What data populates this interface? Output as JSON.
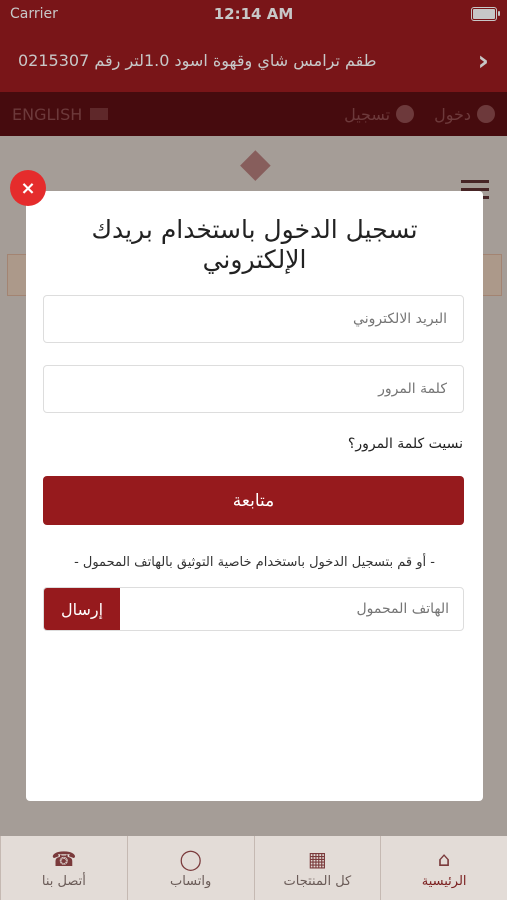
{
  "statusbar": {
    "carrier": "Carrier",
    "time": "12:14 AM"
  },
  "header": {
    "title": "طقم ترامس شاي وقهوة اسود 1.0لتر رقم 0215307",
    "back_icon": "chevron-right-icon"
  },
  "topnav": {
    "language": "ENGLISH",
    "login": "دخول",
    "register": "تسجيل"
  },
  "modal": {
    "title": "تسجيل الدخول باستخدام بريدك الإلكتروني",
    "email_placeholder": "البريد الالكتروني",
    "password_placeholder": "كلمة المرور",
    "forgot": "نسيت كلمة المرور؟",
    "continue": "متابعة",
    "or_text": "- أو قم بتسجيل الدخول باستخدام خاصية التوثيق بالهاتف المحمول -",
    "phone_placeholder": "الهاتف المحمول",
    "send": "إرسال",
    "close": "×"
  },
  "tabbar": [
    {
      "label": "الرئيسية",
      "icon": "home-icon"
    },
    {
      "label": "كل المنتجات",
      "icon": "grid-icon"
    },
    {
      "label": "واتساب",
      "icon": "whatsapp-icon"
    },
    {
      "label": "أتصل بنا",
      "icon": "phone-icon"
    }
  ],
  "colors": {
    "brand": "#9b1b1f",
    "button": "#961a1d",
    "close": "#e52c2c"
  }
}
